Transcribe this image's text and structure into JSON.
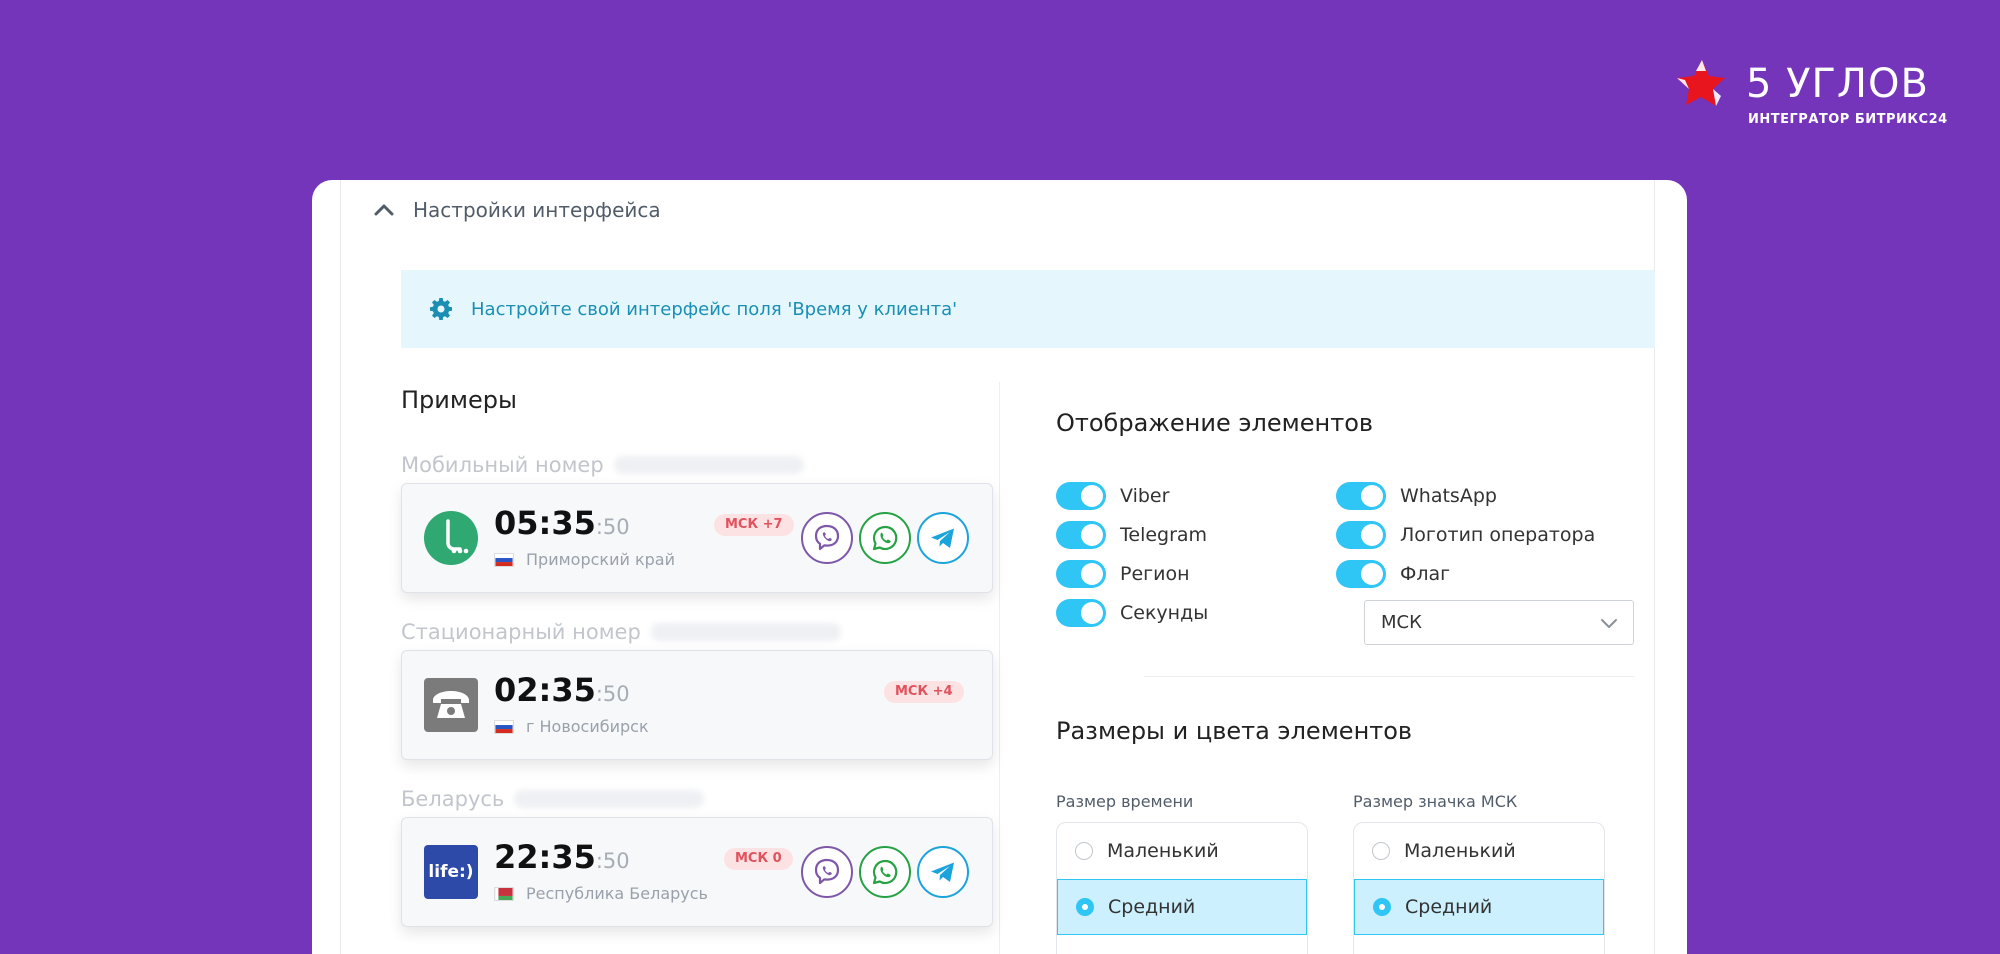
{
  "brand": {
    "name": "5 УГЛОВ",
    "subtitle": "ИНТЕГРАТОР БИТРИКС24",
    "accent": "#e8141e"
  },
  "section": {
    "title": "Настройки интерфейса"
  },
  "info": {
    "text": "Настройте свой интерфейс поля 'Время у клиента'"
  },
  "examples": {
    "title": "Примеры",
    "items": [
      {
        "label": "Мобильный номер",
        "time": "05:35",
        "seconds": ":50",
        "region": "Приморский край",
        "msk": "МСК +7",
        "operator_icon": "megafon-logo"
      },
      {
        "label": "Стационарный номер",
        "time": "02:35",
        "seconds": ":50",
        "region": "г Новосибирск",
        "msk": "МСК +4",
        "operator_icon": "landline-phone-icon"
      },
      {
        "label": "Беларусь",
        "time": "22:35",
        "seconds": ":50",
        "region": "Республика Беларусь",
        "msk": "МСК 0",
        "operator_icon": "life-logo",
        "operator_text": "life:)"
      }
    ]
  },
  "display": {
    "title": "Отображение элементов",
    "toggles_left": [
      "Viber",
      "Telegram",
      "Регион",
      "Секунды"
    ],
    "toggles_right": [
      "WhatsApp",
      "Логотип оператора",
      "Флаг"
    ],
    "timezone_select": "МСК"
  },
  "sizes": {
    "title": "Размеры и цвета элементов",
    "time_size": {
      "label": "Размер времени",
      "options": [
        "Маленький",
        "Средний"
      ],
      "selected": "Средний"
    },
    "msk_size": {
      "label": "Размер значка МСК",
      "options": [
        "Маленький",
        "Средний"
      ],
      "selected": "Средний"
    }
  },
  "colors": {
    "background": "#7435bb",
    "toggle_on": "#2fc6f6",
    "viber": "#7d58a8",
    "whatsapp": "#25a244",
    "telegram": "#1ba3dc",
    "msk_badge_bg": "#fde2e4",
    "msk_badge_text": "#e0525d"
  }
}
